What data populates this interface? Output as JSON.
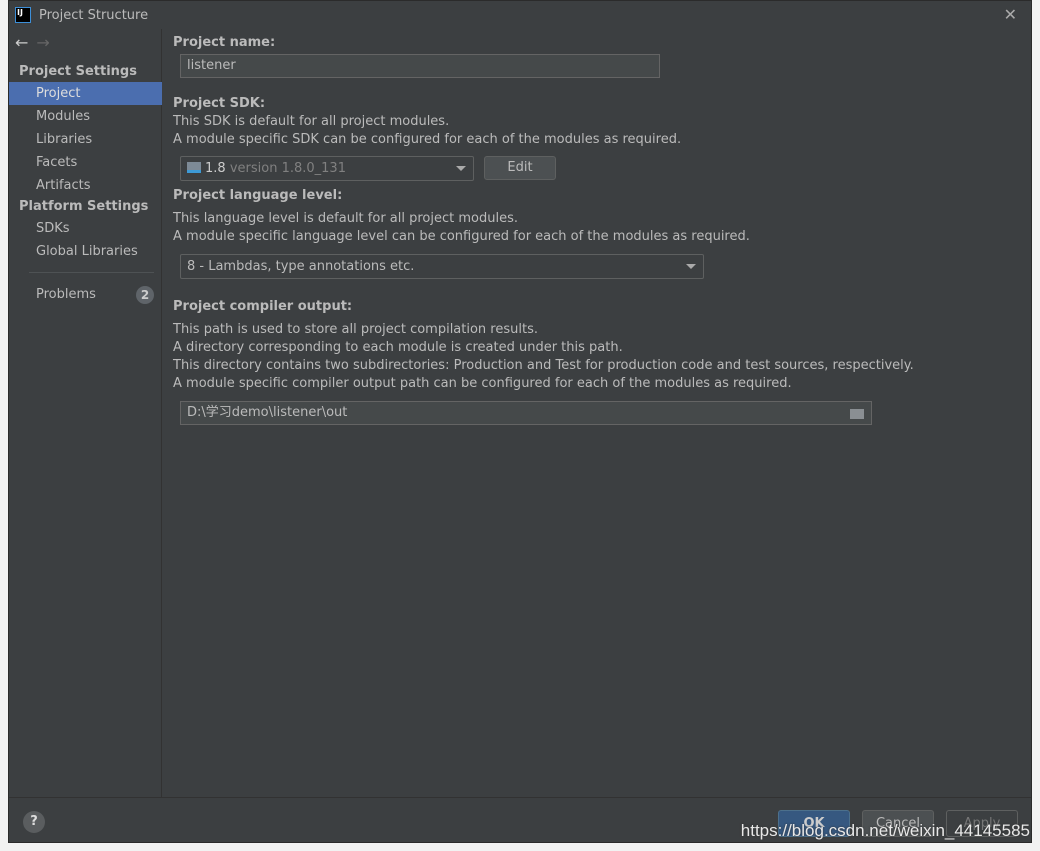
{
  "window": {
    "title": "Project Structure",
    "app_icon": "IJ"
  },
  "sidebar": {
    "groups": [
      "Project Settings",
      "Platform Settings"
    ],
    "items": [
      {
        "label": "Project",
        "selected": true
      },
      {
        "label": "Modules"
      },
      {
        "label": "Libraries"
      },
      {
        "label": "Facets"
      },
      {
        "label": "Artifacts"
      },
      {
        "label": "SDKs"
      },
      {
        "label": "Global Libraries"
      },
      {
        "label": "Problems",
        "badge": "2"
      }
    ]
  },
  "main": {
    "name_label": "Project name:",
    "name_value": "listener",
    "sdk_label": "Project SDK:",
    "sdk_desc1": "This SDK is default for all project modules.",
    "sdk_desc2": "A module specific SDK can be configured for each of the modules as required.",
    "sdk_value": "1.8",
    "sdk_version": "version 1.8.0_131",
    "edit": "Edit",
    "lang_label": "Project language level:",
    "lang_desc1": "This language level is default for all project modules.",
    "lang_desc2": "A module specific language level can be configured for each of the modules as required.",
    "lang_value": "8 - Lambdas, type annotations etc.",
    "out_label": "Project compiler output:",
    "out_desc1": "This path is used to store all project compilation results.",
    "out_desc2": "A directory corresponding to each module is created under this path.",
    "out_desc3": "This directory contains two subdirectories: Production and Test for production code and test sources, respectively.",
    "out_desc4": "A module specific compiler output path can be configured for each of the modules as required.",
    "out_value": "D:\\学习demo\\listener\\out"
  },
  "footer": {
    "help": "?",
    "ok": "OK",
    "cancel": "Cancel",
    "apply": "Apply"
  },
  "watermark": "https://blog.csdn.net/weixin_44145585",
  "colors": {
    "background": "#3c3f41",
    "selection": "#4b6eaf",
    "ok_button": "#365880"
  }
}
